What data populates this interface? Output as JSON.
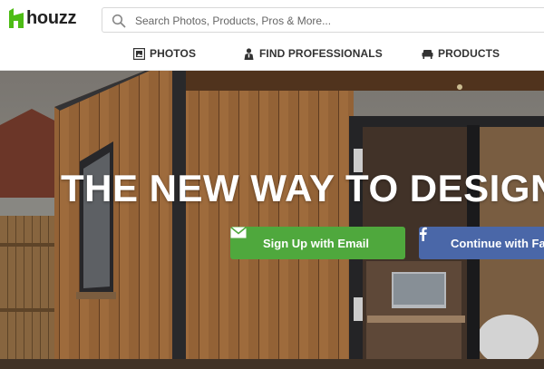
{
  "header": {
    "logo_text": "houzz",
    "logo_icon": "houzz-logo-icon",
    "search": {
      "placeholder": "Search Photos, Products, Pros & More...",
      "value": "",
      "icon": "search-icon"
    }
  },
  "nav": {
    "items": [
      {
        "label": "PHOTOS",
        "icon": "photos-icon"
      },
      {
        "label": "FIND PROFESSIONALS",
        "icon": "professional-icon"
      },
      {
        "label": "PRODUCTS",
        "icon": "sofa-icon"
      }
    ]
  },
  "hero": {
    "title": "THE NEW WAY TO DESIGN",
    "buttons": {
      "email_label": "Sign Up with Email",
      "email_icon": "envelope-icon",
      "facebook_label": "Continue with Fa",
      "facebook_icon": "facebook-icon"
    }
  },
  "colors": {
    "brand_green": "#4fa83d",
    "facebook_blue": "#4a67a8",
    "text_dark": "#333333"
  }
}
